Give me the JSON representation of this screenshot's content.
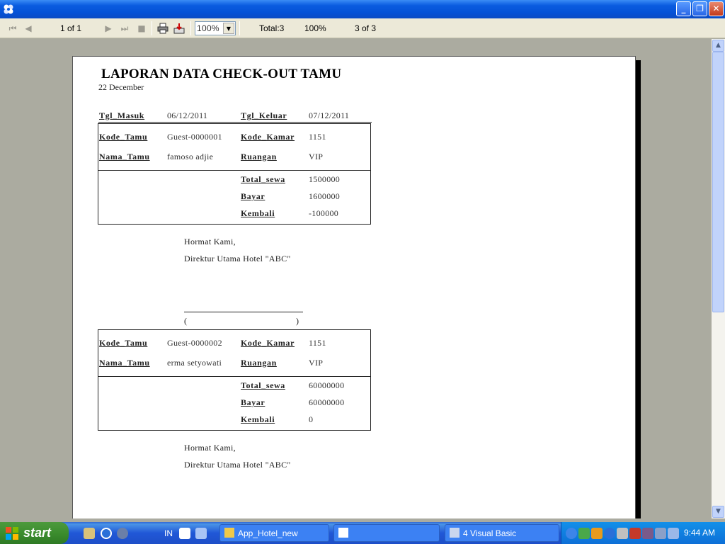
{
  "window": {
    "title": ""
  },
  "toolbar": {
    "page_indicator": "1 of 1",
    "zoom_value": "100%",
    "total": "Total:3",
    "percent": "100%",
    "record": "3 of 3"
  },
  "report": {
    "title": "LAPORAN DATA CHECK-OUT TAMU",
    "date": "22 December",
    "header": {
      "tgl_masuk_label": "Tgl_Masuk",
      "tgl_masuk_value": "06/12/2011",
      "tgl_keluar_label": "Tgl_Keluar",
      "tgl_keluar_value": "07/12/2011"
    },
    "labels": {
      "kode_tamu": "Kode_Tamu",
      "nama_tamu": "Nama_Tamu",
      "kode_kamar": "Kode_Kamar",
      "ruangan": "Ruangan",
      "total_sewa": "Total_sewa",
      "bayar": "Bayar",
      "kembali": "Kembali"
    },
    "records": [
      {
        "kode_tamu": "Guest-0000001",
        "nama_tamu": "famoso adjie",
        "kode_kamar": "1151",
        "ruangan": "VIP",
        "total_sewa": "1500000",
        "bayar": "1600000",
        "kembali": "-100000"
      },
      {
        "kode_tamu": "Guest-0000002",
        "nama_tamu": "erma setyowati",
        "kode_kamar": "1151",
        "ruangan": "VIP",
        "total_sewa": "60000000",
        "bayar": "60000000",
        "kembali": "0"
      }
    ],
    "signature": {
      "greeting": "Hormat Kami,",
      "position": "Direktur Utama Hotel \"ABC\"",
      "paren_open": "(",
      "paren_close": ")"
    }
  },
  "taskbar": {
    "start_label": "start",
    "language": "IN",
    "tasks": [
      {
        "label": "App_Hotel_new"
      },
      {
        "label": ""
      },
      {
        "label": "4 Visual Basic"
      }
    ],
    "clock": "9:44 AM"
  }
}
